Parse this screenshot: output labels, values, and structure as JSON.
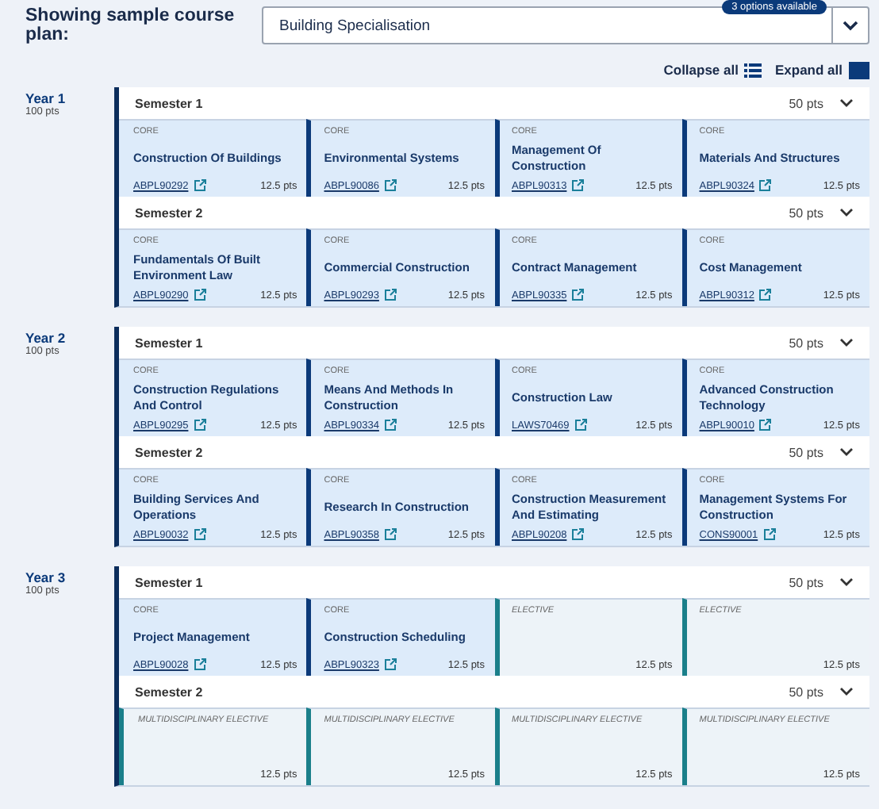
{
  "plan_selector": {
    "label": "Showing sample course plan:",
    "value": "Building Specialisation",
    "badge": "3 options available"
  },
  "actions": {
    "collapse": "Collapse all",
    "expand": "Expand all"
  },
  "years": [
    {
      "title": "Year 1",
      "points": "100 pts",
      "semesters": [
        {
          "title": "Semester 1",
          "points": "50 pts",
          "subjects": [
            {
              "kind": "core",
              "type": "CORE",
              "name": "Construction Of Buildings",
              "code": "ABPL90292",
              "points": "12.5 pts"
            },
            {
              "kind": "core",
              "type": "CORE",
              "name": "Environmental Systems",
              "code": "ABPL90086",
              "points": "12.5 pts"
            },
            {
              "kind": "core",
              "type": "CORE",
              "name": "Management Of Construction",
              "code": "ABPL90313",
              "points": "12.5 pts"
            },
            {
              "kind": "core",
              "type": "CORE",
              "name": "Materials And Structures",
              "code": "ABPL90324",
              "points": "12.5 pts"
            }
          ]
        },
        {
          "title": "Semester 2",
          "points": "50 pts",
          "subjects": [
            {
              "kind": "core",
              "type": "CORE",
              "name": "Fundamentals Of Built Environment Law",
              "code": "ABPL90290",
              "points": "12.5 pts"
            },
            {
              "kind": "core",
              "type": "CORE",
              "name": "Commercial Construction",
              "code": "ABPL90293",
              "points": "12.5 pts"
            },
            {
              "kind": "core",
              "type": "CORE",
              "name": "Contract Management",
              "code": "ABPL90335",
              "points": "12.5 pts"
            },
            {
              "kind": "core",
              "type": "CORE",
              "name": "Cost Management",
              "code": "ABPL90312",
              "points": "12.5 pts"
            }
          ]
        }
      ]
    },
    {
      "title": "Year 2",
      "points": "100 pts",
      "semesters": [
        {
          "title": "Semester 1",
          "points": "50 pts",
          "subjects": [
            {
              "kind": "core",
              "type": "CORE",
              "name": "Construction Regulations And Control",
              "code": "ABPL90295",
              "points": "12.5 pts"
            },
            {
              "kind": "core",
              "type": "CORE",
              "name": "Means And Methods In Construction",
              "code": "ABPL90334",
              "points": "12.5 pts"
            },
            {
              "kind": "core",
              "type": "CORE",
              "name": "Construction Law",
              "code": "LAWS70469",
              "points": "12.5 pts"
            },
            {
              "kind": "core",
              "type": "CORE",
              "name": "Advanced Construction Technology",
              "code": "ABPL90010",
              "points": "12.5 pts"
            }
          ]
        },
        {
          "title": "Semester 2",
          "points": "50 pts",
          "subjects": [
            {
              "kind": "core",
              "type": "CORE",
              "name": "Building Services And Operations",
              "code": "ABPL90032",
              "points": "12.5 pts"
            },
            {
              "kind": "core",
              "type": "CORE",
              "name": "Research In Construction",
              "code": "ABPL90358",
              "points": "12.5 pts"
            },
            {
              "kind": "core",
              "type": "CORE",
              "name": "Construction Measurement And Estimating",
              "code": "ABPL90208",
              "points": "12.5 pts"
            },
            {
              "kind": "core",
              "type": "CORE",
              "name": "Management Systems For Construction",
              "code": "CONS90001",
              "points": "12.5 pts"
            }
          ]
        }
      ]
    },
    {
      "title": "Year 3",
      "points": "100 pts",
      "semesters": [
        {
          "title": "Semester 1",
          "points": "50 pts",
          "subjects": [
            {
              "kind": "core",
              "type": "CORE",
              "name": "Project Management",
              "code": "ABPL90028",
              "points": "12.5 pts"
            },
            {
              "kind": "core",
              "type": "CORE",
              "name": "Construction Scheduling",
              "code": "ABPL90323",
              "points": "12.5 pts"
            },
            {
              "kind": "elective",
              "type": "ELECTIVE",
              "points": "12.5 pts"
            },
            {
              "kind": "elective",
              "type": "ELECTIVE",
              "points": "12.5 pts"
            }
          ]
        },
        {
          "title": "Semester 2",
          "points": "50 pts",
          "subjects": [
            {
              "kind": "elective",
              "type": "MULTIDISCIPLINARY ELECTIVE",
              "points": "12.5 pts"
            },
            {
              "kind": "elective",
              "type": "MULTIDISCIPLINARY ELECTIVE",
              "points": "12.5 pts"
            },
            {
              "kind": "elective",
              "type": "MULTIDISCIPLINARY ELECTIVE",
              "points": "12.5 pts"
            },
            {
              "kind": "elective",
              "type": "MULTIDISCIPLINARY ELECTIVE",
              "points": "12.5 pts"
            }
          ]
        }
      ]
    }
  ]
}
